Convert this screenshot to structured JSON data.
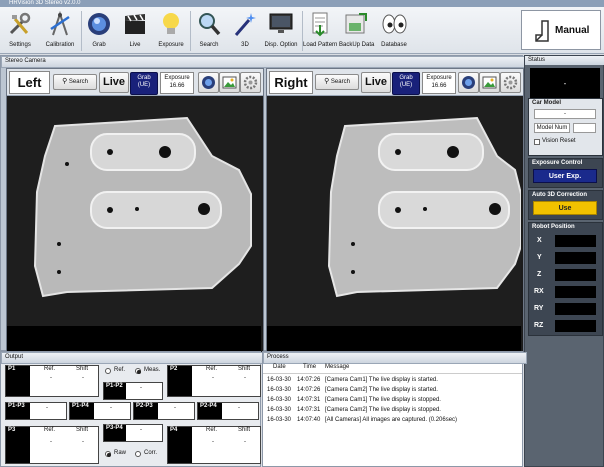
{
  "window": {
    "title": "HRVision 3D Stereo v2.0.0"
  },
  "toolbar": {
    "items": [
      {
        "label": "Settings",
        "icon": "tools-icon"
      },
      {
        "label": "Calibration",
        "icon": "calibration-icon"
      },
      {
        "label": "Grab",
        "icon": "grab-icon"
      },
      {
        "label": "Live",
        "icon": "clapper-icon"
      },
      {
        "label": "Exposure",
        "icon": "lightbulb-icon"
      },
      {
        "label": "Search",
        "icon": "magnifier-icon"
      },
      {
        "label": "3D",
        "icon": "wand-icon"
      },
      {
        "label": "Disp. Option",
        "icon": "monitor-icon"
      },
      {
        "label": "Load Pattern",
        "icon": "load-pattern-icon"
      },
      {
        "label": "BackUp Data",
        "icon": "backup-icon"
      },
      {
        "label": "Database",
        "icon": "eyes-icon"
      }
    ],
    "mode": "Manual"
  },
  "stereo": {
    "title": "Stereo Camera",
    "left": {
      "title": "Left",
      "search": "Search",
      "live": "Live",
      "grab": "Grab",
      "grab_sub": "(UE)",
      "exposure_label": "Exposure",
      "exposure_value": "16.66"
    },
    "right": {
      "title": "Right",
      "search": "Search",
      "live": "Live",
      "grab": "Grab",
      "grab_sub": "(UE)",
      "exposure_label": "Exposure",
      "exposure_value": "16.66"
    }
  },
  "status": {
    "title": "Status",
    "display": "-",
    "car_model": {
      "title": "Car Model",
      "value": "-",
      "model_num": "Model Num",
      "vision_reset": "Vision Reset"
    },
    "exposure_control": {
      "title": "Exposure Control",
      "button": "User Exp."
    },
    "auto3d": {
      "title": "Auto 3D Correction",
      "button": "Use"
    },
    "robot": {
      "title": "Robot Position",
      "axes": [
        "X",
        "Y",
        "Z",
        "RX",
        "RY",
        "RZ"
      ]
    }
  },
  "output": {
    "title": "Output",
    "ref": "Ref.",
    "shift": "Shift",
    "tables": [
      "P1",
      "P2",
      "P3",
      "P4"
    ],
    "pairs": [
      "P1-P2",
      "P1-P3",
      "P1-P4",
      "P2-P3",
      "P2-P4",
      "P3-P4"
    ],
    "radio1": {
      "ref": "Ref.",
      "meas": "Meas."
    },
    "radio2": {
      "raw": "Raw",
      "corr": "Corr."
    },
    "dash": "-"
  },
  "process": {
    "title": "Process",
    "columns": [
      "Date",
      "Time",
      "Message"
    ],
    "rows": [
      {
        "date": "16-03-30",
        "time": "14:07:26",
        "message": "[Camera Cam1] The live display is started."
      },
      {
        "date": "16-03-30",
        "time": "14:07:26",
        "message": "[Camera Cam2] The live display is started."
      },
      {
        "date": "16-03-30",
        "time": "14:07:31",
        "message": "[Camera Cam1] The live display is stopped."
      },
      {
        "date": "16-03-30",
        "time": "14:07:31",
        "message": "[Camera Cam2] The live display is stopped."
      },
      {
        "date": "16-03-30",
        "time": "14:07:40",
        "message": "[All Cameras] All images are captured. (0.206sec)"
      }
    ]
  },
  "colors": {
    "grab": "#19217a",
    "exposure_btn": "#1a2a8c",
    "use_btn": "#f2c200",
    "status_bg": "#5a6470"
  }
}
